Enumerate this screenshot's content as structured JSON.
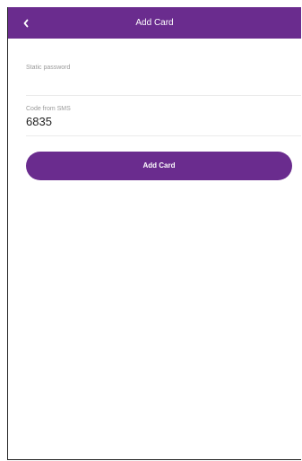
{
  "header": {
    "title": "Add Card",
    "back_icon": "chevron-left-icon"
  },
  "form": {
    "static_password": {
      "label": "Static password",
      "value": ""
    },
    "sms_code": {
      "label": "Code from SMS",
      "value": "6835"
    },
    "submit_label": "Add Card"
  },
  "colors": {
    "brand": "#6a2c8e",
    "label": "#9a9a9a",
    "divider": "#ebebeb"
  }
}
